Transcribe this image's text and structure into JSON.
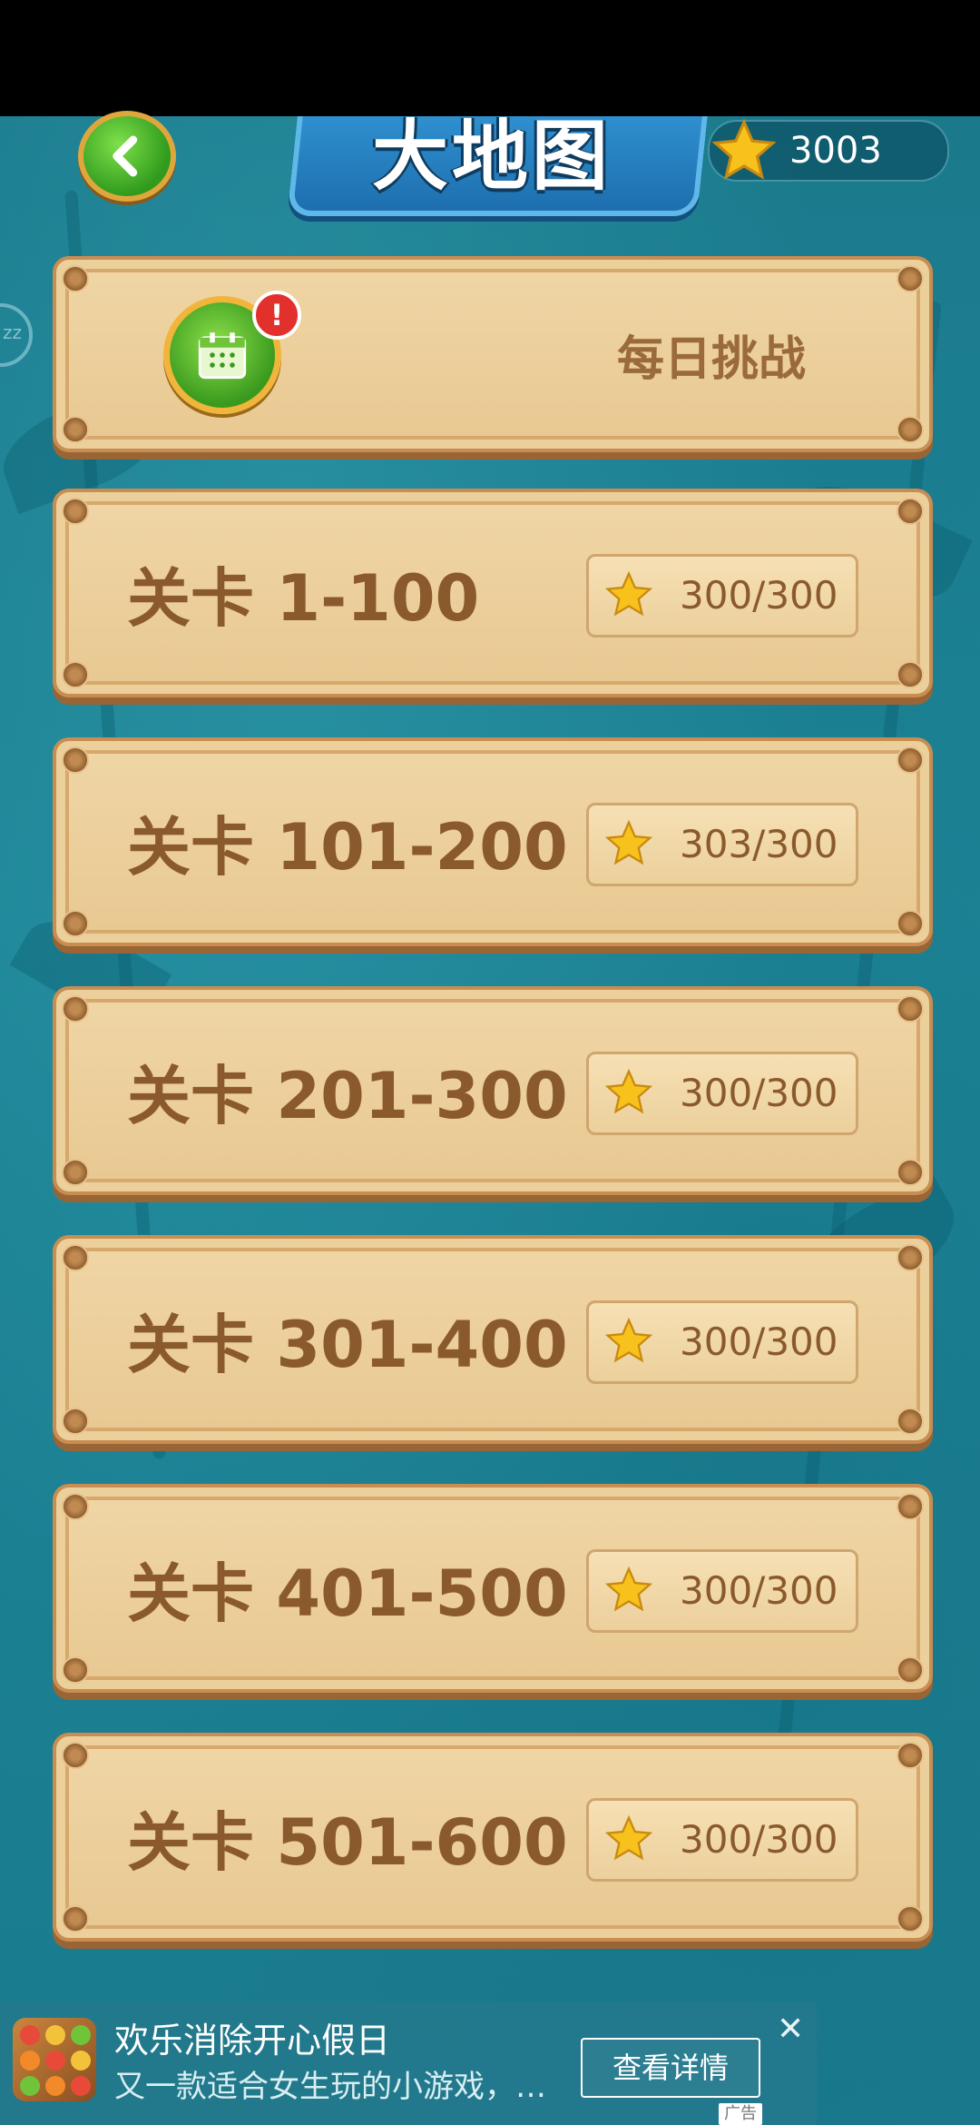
{
  "header": {
    "title": "大地图",
    "star_total": "3003",
    "side_badge": "zz"
  },
  "daily": {
    "label": "每日挑战",
    "badge": "!"
  },
  "levels": [
    {
      "label": "关卡 1-100",
      "score": "300/300"
    },
    {
      "label": "关卡 101-200",
      "score": "303/300"
    },
    {
      "label": "关卡 201-300",
      "score": "300/300"
    },
    {
      "label": "关卡 301-400",
      "score": "300/300"
    },
    {
      "label": "关卡 401-500",
      "score": "300/300"
    },
    {
      "label": "关卡 501-600",
      "score": "300/300"
    }
  ],
  "ad": {
    "title": "欢乐消除开心假日",
    "description": "又一款适合女生玩的小游戏，…",
    "button": "查看详情",
    "close": "✕",
    "tag": "广告"
  },
  "colors": {
    "background": "#1b7c8f",
    "panel": "#ecd09c",
    "panel_text": "#8a5a2c",
    "title_blue": "#2f8fcf",
    "star": "#f7c21c"
  },
  "icons": {
    "back": "chevron-left-icon",
    "star": "star-icon",
    "daily": "calendar-icon",
    "alert": "exclamation-icon",
    "close": "close-icon"
  }
}
